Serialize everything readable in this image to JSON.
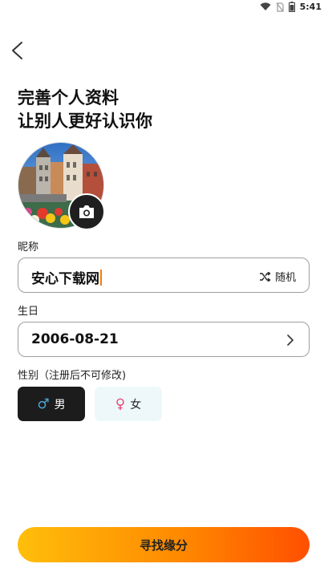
{
  "status_bar": {
    "time": "5:41"
  },
  "header": {
    "title_line1": "完善个人资料",
    "title_line2": "让别人更好认识你"
  },
  "profile": {
    "nickname_label": "昵称",
    "nickname_value": "安心下载网",
    "random_label": "随机",
    "birthday_label": "生日",
    "birthday_value": "2006-08-21",
    "gender_label": "性别（注册后不可修改)",
    "gender_male": "男",
    "gender_female": "女",
    "selected_gender": "男"
  },
  "actions": {
    "submit_label": "寻找缘分"
  },
  "colors": {
    "primary_gradient_start": "#ffbe0b",
    "primary_gradient_end": "#ff4f00",
    "selected_dark": "#1c1c1c",
    "male_symbol": "#4aa8d8",
    "female_symbol": "#e84a7a"
  },
  "icons": {
    "back": "back-arrow-icon",
    "camera": "camera-icon",
    "random": "shuffle-icon",
    "chevron": "chevron-right-icon",
    "male": "male-symbol-icon",
    "female": "female-symbol-icon"
  }
}
